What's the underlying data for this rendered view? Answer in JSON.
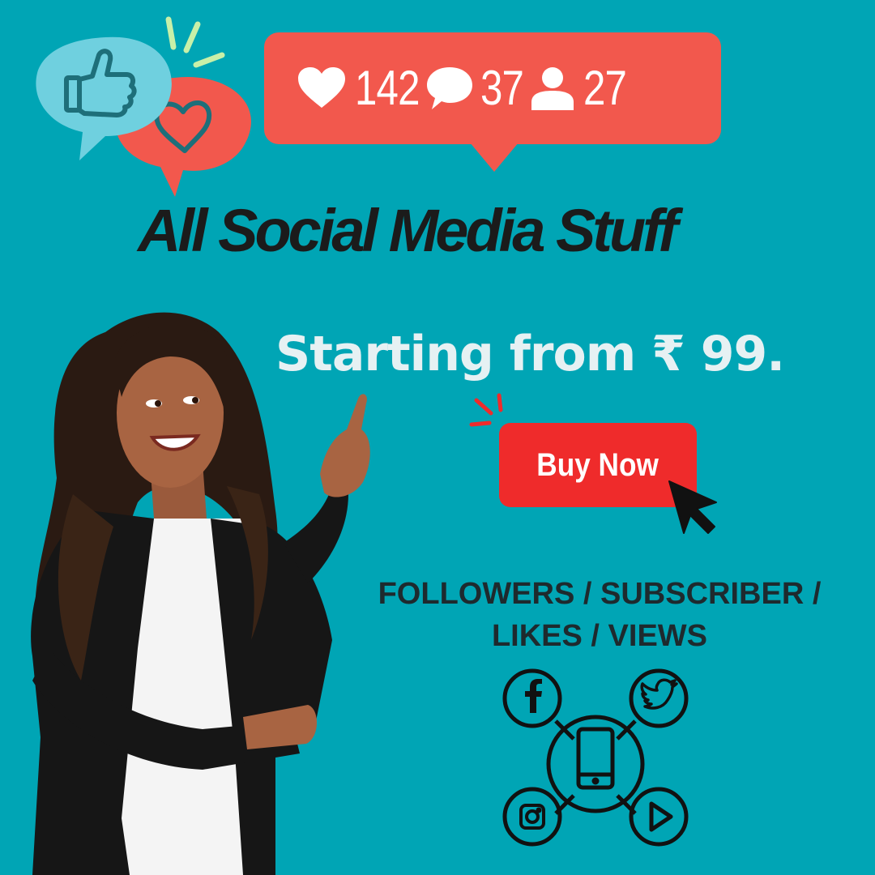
{
  "notification": {
    "likes": "142",
    "comments": "37",
    "followers": "27"
  },
  "headline": "All Social Media Stuff",
  "price_text": "Starting from ₹ 99.",
  "cta": {
    "label": "Buy Now"
  },
  "services": {
    "line1": "FOLLOWERS / SUBSCRIBER /",
    "line2": "LIKES / VIEWS"
  },
  "icons": [
    "thumbs-up-icon",
    "heart-icon",
    "comment-icon",
    "user-icon",
    "facebook-icon",
    "twitter-icon",
    "instagram-icon",
    "play-icon",
    "smartphone-icon",
    "cursor-icon"
  ],
  "colors": {
    "background": "#00a5b5",
    "notification": "#f2584d",
    "button": "#ef2b2b",
    "headline": "#1b1b1b",
    "price": "#e6f1f3"
  }
}
